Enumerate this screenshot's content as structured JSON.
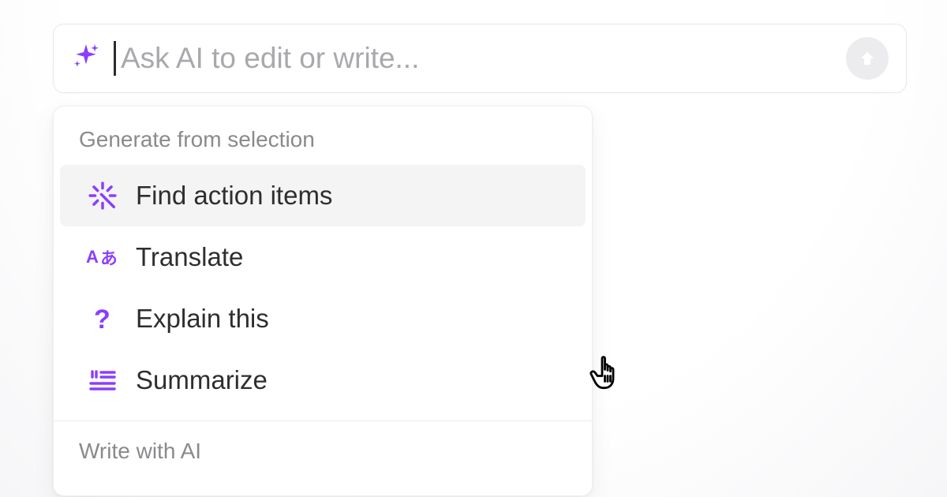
{
  "colors": {
    "accent": "#8b3dff",
    "placeholder": "#a9a9ad",
    "send_bg": "#ececee",
    "send_arrow": "#ffffff",
    "text": "#2e2e31",
    "muted": "#8a8a8e"
  },
  "input": {
    "placeholder": "Ask AI to edit or write...",
    "value": ""
  },
  "menu": {
    "section1_header": "Generate from selection",
    "items": [
      {
        "icon": "wand-icon",
        "label": "Find action items",
        "highlighted": true
      },
      {
        "icon": "translate-icon",
        "label": "Translate",
        "highlighted": false
      },
      {
        "icon": "question-icon",
        "label": "Explain this",
        "highlighted": false
      },
      {
        "icon": "summarize-icon",
        "label": "Summarize",
        "highlighted": false
      }
    ],
    "section2_header": "Write with AI"
  }
}
